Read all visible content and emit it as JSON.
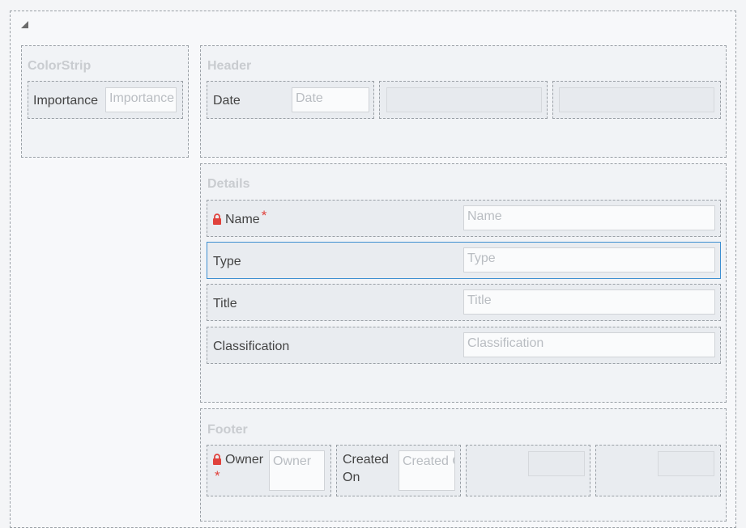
{
  "colorstrip": {
    "title": "ColorStrip",
    "importance_label": "Importance",
    "importance_placeholder": "Importance"
  },
  "header": {
    "title": "Header",
    "date_label": "Date",
    "date_placeholder": "Date"
  },
  "details": {
    "title": "Details",
    "fields": [
      {
        "label": "Name",
        "placeholder": "Name",
        "required": "*",
        "locked": true
      },
      {
        "label": "Type",
        "placeholder": "Type"
      },
      {
        "label": "Title",
        "placeholder": "Title"
      },
      {
        "label": "Classification",
        "placeholder": "Classification"
      }
    ]
  },
  "footer": {
    "title": "Footer",
    "owner_label": "Owner",
    "owner_required": "*",
    "owner_placeholder": "Owner",
    "created_label_line1": "Created",
    "created_label_line2": "On",
    "created_placeholder": "Created On"
  },
  "colors": {
    "required": "#e0423c",
    "selection": "#3d8fd1",
    "section_title": "#c9ccd0"
  },
  "icons": [
    "collapse-triangle-icon",
    "lock-icon"
  ]
}
